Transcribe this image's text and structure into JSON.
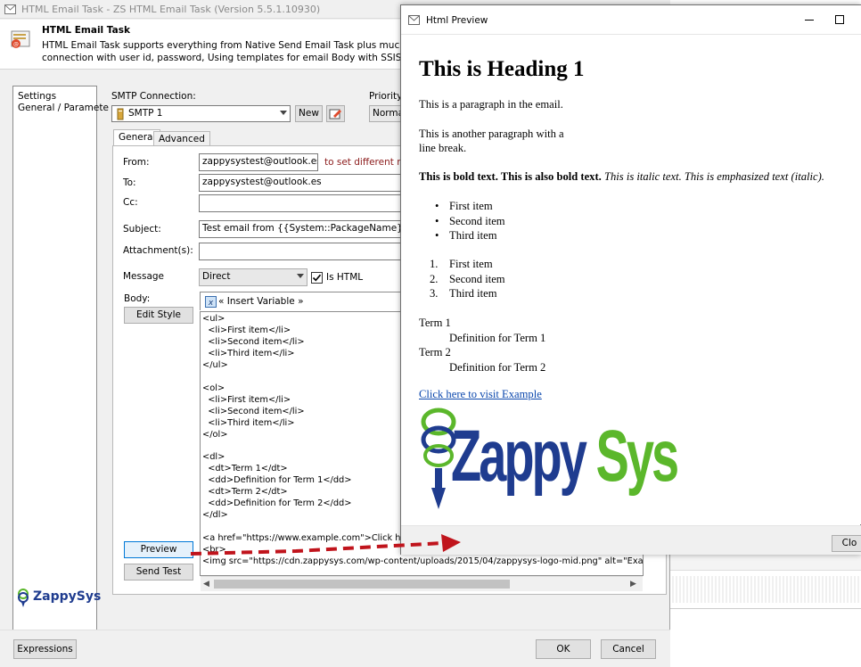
{
  "window": {
    "title": "HTML Email Task - ZS HTML Email Task (Version 5.5.1.10930)"
  },
  "header": {
    "title": "HTML Email Task",
    "description_line1": "HTML Email Task supports everything from Native Send Email Task plus much more such",
    "description_line2": "connection with user id, password, Using templates for email Body with SSIS Variable plac"
  },
  "nav": {
    "items": [
      "Settings",
      "General / Paramete"
    ]
  },
  "smtp": {
    "label": "SMTP Connection:",
    "value": "SMTP 1",
    "new_label": "New",
    "priority_label": "Priority:",
    "priority_value": "Norma"
  },
  "tabs": [
    "General",
    "Advanced"
  ],
  "fields": {
    "from_label": "From:",
    "from_value": "zappysystest@outlook.es",
    "from_hint": "to set different repl",
    "to_label": "To:",
    "to_value": "zappysystest@outlook.es",
    "cc_label": "Cc:",
    "cc_value": "",
    "subject_label": "Subject:",
    "subject_value": "Test email from {{System::PackageName}}",
    "attachment_label": "Attachment(s):",
    "attachment_value": "",
    "message_label": "Message",
    "message_value": "Direct",
    "is_html_label": "Is HTML",
    "is_html_checked": true,
    "body_label": "Body:",
    "edit_style_label": "Edit Style",
    "insert_variable_label": "« Insert Variable »",
    "preview_label": "Preview",
    "send_test_label": "Send Test"
  },
  "body_code": "<ul>\n  <li>First item</li>\n  <li>Second item</li>\n  <li>Third item</li>\n</ul>\n\n<ol>\n  <li>First item</li>\n  <li>Second item</li>\n  <li>Third item</li>\n</ol>\n\n<dl>\n  <dt>Term 1</dt>\n  <dd>Definition for Term 1</dd>\n  <dt>Term 2</dt>\n  <dd>Definition for Term 2</dd>\n</dl>\n\n<a href=\"https://www.example.com\">Click here\n<br>\n<img src=\"https://cdn.zappysys.com/wp-content/uploads/2015/04/zappysys-logo-mid.png\" alt=\"Exampl",
  "footer": {
    "expressions_label": "Expressions",
    "ok_label": "OK",
    "cancel_label": "Cancel",
    "logo_text": "ZappySys"
  },
  "preview": {
    "title": "Html Preview",
    "heading": "This is Heading 1",
    "p1": "This is a paragraph in the email.",
    "p2_line1": "This is another paragraph with a",
    "p2_line2": "line break.",
    "bold_text": "This is bold text. This is also bold text.",
    "italic_text": " This is italic text. This is emphasized text (italic).",
    "ul": [
      "First item",
      "Second item",
      "Third item"
    ],
    "ol": [
      "First item",
      "Second item",
      "Third item"
    ],
    "ol_numbers": [
      "1.",
      "2.",
      "3."
    ],
    "dl": [
      {
        "term": "Term 1",
        "def": "Definition for Term 1"
      },
      {
        "term": "Term 2",
        "def": "Definition for Term 2"
      }
    ],
    "link_text": "Click here to visit Example",
    "logo_text": "ZappySys",
    "close_label": "Clo"
  },
  "colors": {
    "link": "#0b47ad",
    "hint_red": "#8b1a1a",
    "arrow_red": "#c0141c",
    "logo_blue": "#1f3c8f",
    "logo_green": "#5bb72b"
  }
}
